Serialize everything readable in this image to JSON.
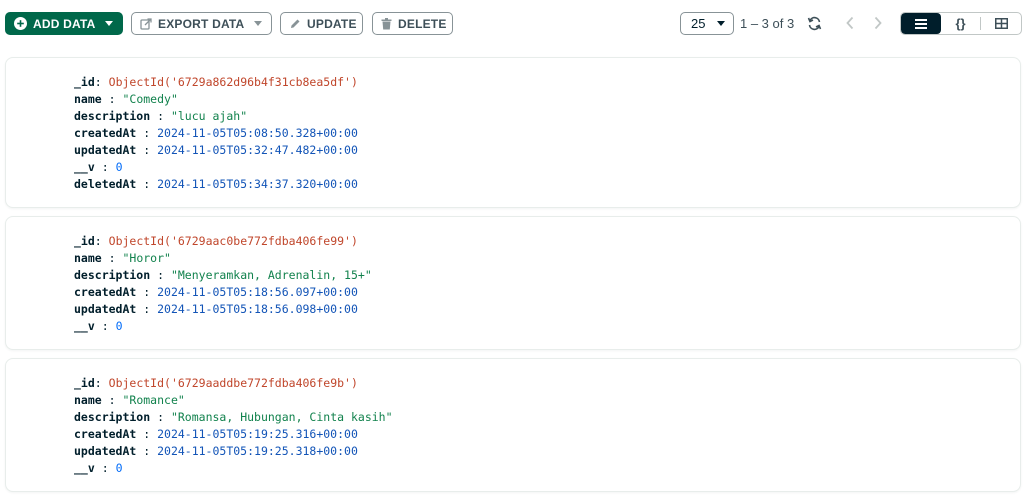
{
  "toolbar": {
    "add_data": "ADD DATA",
    "export_data": "EXPORT DATA",
    "update": "UPDATE",
    "delete": "DELETE",
    "page_size": "25",
    "range": "1 – 3 of 3",
    "view_json": "{}"
  },
  "documents": [
    {
      "fields": [
        {
          "key": "_id",
          "value": "ObjectId('6729a862d96b4f31cb8ea5df')",
          "type": "oid"
        },
        {
          "key": "name",
          "value": "\"Comedy\"",
          "type": "str"
        },
        {
          "key": "description",
          "value": "\"lucu ajah\"",
          "type": "str"
        },
        {
          "key": "createdAt",
          "value": "2024-11-05T05:08:50.328+00:00",
          "type": "date"
        },
        {
          "key": "updatedAt",
          "value": "2024-11-05T05:32:47.482+00:00",
          "type": "date"
        },
        {
          "key": "__v",
          "value": "0",
          "type": "num"
        },
        {
          "key": "deletedAt",
          "value": "2024-11-05T05:34:37.320+00:00",
          "type": "date"
        }
      ]
    },
    {
      "fields": [
        {
          "key": "_id",
          "value": "ObjectId('6729aac0be772fdba406fe99')",
          "type": "oid"
        },
        {
          "key": "name",
          "value": "\"Horor\"",
          "type": "str"
        },
        {
          "key": "description",
          "value": "\"Menyeramkan, Adrenalin, 15+\"",
          "type": "str"
        },
        {
          "key": "createdAt",
          "value": "2024-11-05T05:18:56.097+00:00",
          "type": "date"
        },
        {
          "key": "updatedAt",
          "value": "2024-11-05T05:18:56.098+00:00",
          "type": "date"
        },
        {
          "key": "__v",
          "value": "0",
          "type": "num"
        }
      ]
    },
    {
      "fields": [
        {
          "key": "_id",
          "value": "ObjectId('6729aaddbe772fdba406fe9b')",
          "type": "oid"
        },
        {
          "key": "name",
          "value": "\"Romance\"",
          "type": "str"
        },
        {
          "key": "description",
          "value": "\"Romansa, Hubungan, Cinta kasih\"",
          "type": "str"
        },
        {
          "key": "createdAt",
          "value": "2024-11-05T05:19:25.316+00:00",
          "type": "date"
        },
        {
          "key": "updatedAt",
          "value": "2024-11-05T05:19:25.318+00:00",
          "type": "date"
        },
        {
          "key": "__v",
          "value": "0",
          "type": "num"
        }
      ]
    }
  ]
}
